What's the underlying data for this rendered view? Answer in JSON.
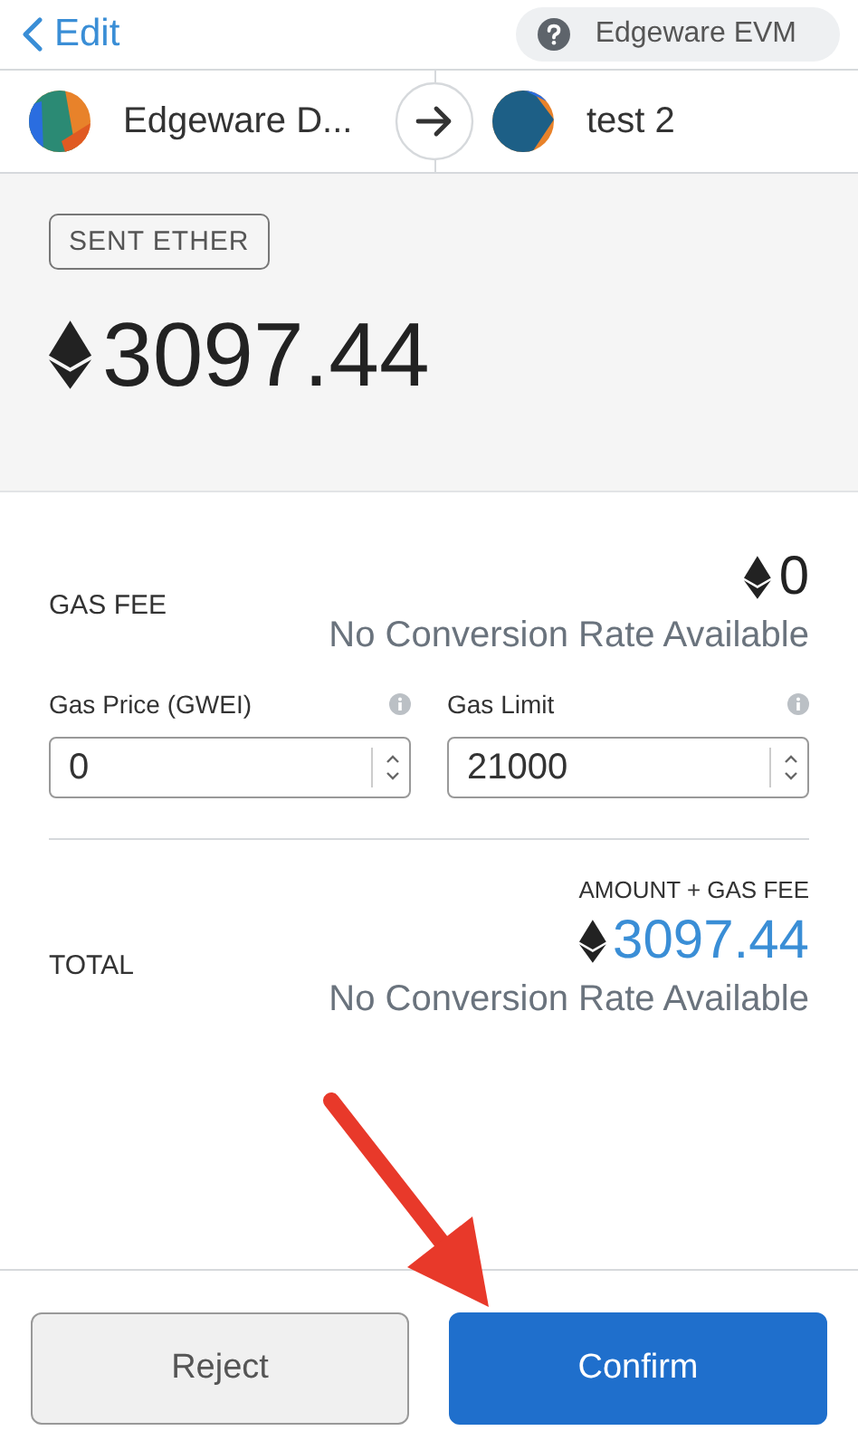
{
  "header": {
    "back_label": "Edit",
    "network": "Edgeware EVM"
  },
  "accounts": {
    "from": "Edgeware D...",
    "to": "test 2"
  },
  "sent": {
    "badge": "SENT ETHER",
    "amount": "3097.44"
  },
  "gas_fee": {
    "label": "GAS FEE",
    "amount": "0",
    "conversion": "No Conversion Rate Available"
  },
  "gas_inputs": [
    {
      "label": "Gas Price (GWEI)",
      "value": "0"
    },
    {
      "label": "Gas Limit",
      "value": "21000"
    }
  ],
  "total": {
    "caption": "AMOUNT + GAS FEE",
    "label": "TOTAL",
    "amount": "3097.44",
    "conversion": "No Conversion Rate Available"
  },
  "buttons": [
    {
      "label": "Reject",
      "kind": "secondary"
    },
    {
      "label": "Confirm",
      "kind": "primary"
    }
  ]
}
